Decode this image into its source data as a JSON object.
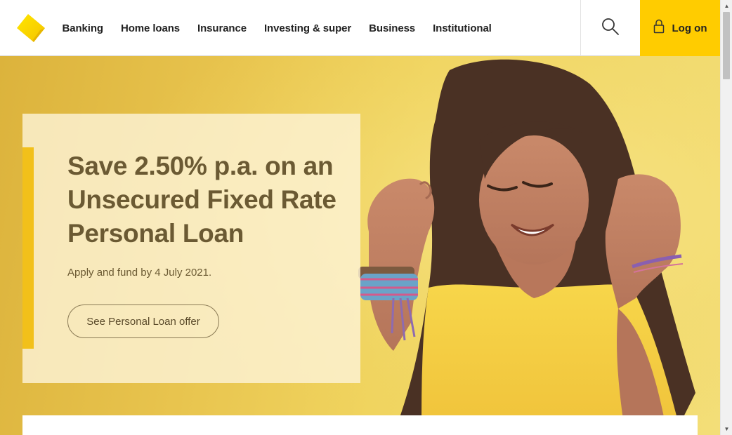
{
  "header": {
    "logo_icon": "commbank-diamond-logo",
    "nav": [
      {
        "label": "Banking"
      },
      {
        "label": "Home loans"
      },
      {
        "label": "Insurance"
      },
      {
        "label": "Investing & super"
      },
      {
        "label": "Business"
      },
      {
        "label": "Institutional"
      }
    ],
    "search_icon": "search-icon",
    "login": {
      "label": "Log on",
      "icon": "lock-icon"
    }
  },
  "hero": {
    "title": "Save 2.50% p.a. on an Unsecured Fixed Rate Personal Loan",
    "subtitle": "Apply and fund by 4 July 2021.",
    "cta_label": "See Personal Loan offer",
    "image": "woman-celebrating-photo"
  },
  "colors": {
    "brand_yellow": "#ffcc00",
    "accent_bar": "#f2c01a",
    "text_dark": "#222222",
    "promo_text": "#6b5a33"
  }
}
